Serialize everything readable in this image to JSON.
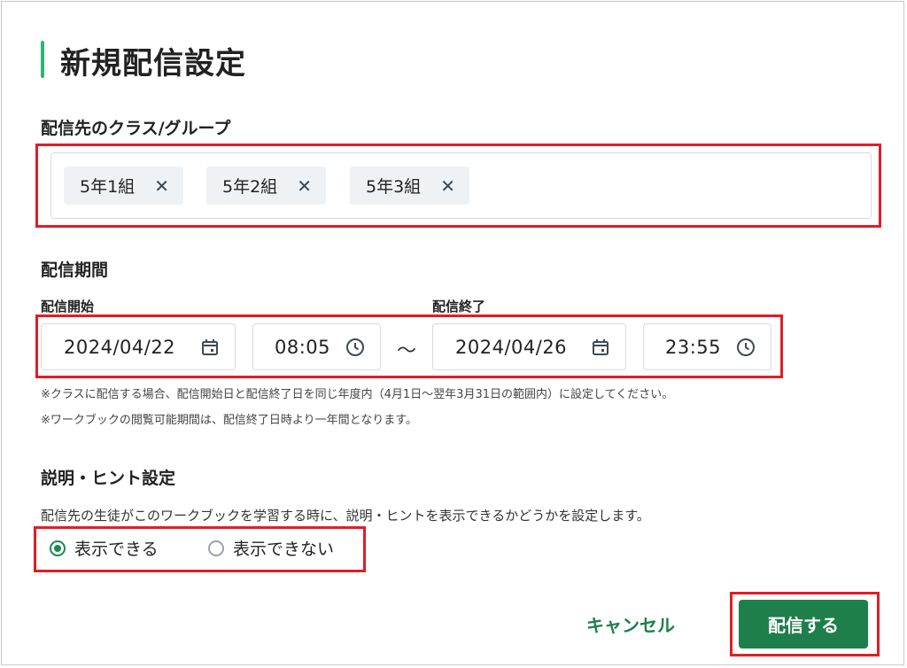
{
  "page": {
    "title": "新規配信設定"
  },
  "classes": {
    "label": "配信先のクラス/グループ",
    "chips": [
      {
        "label": "5年1組",
        "remove_icon": "✕"
      },
      {
        "label": "5年2組",
        "remove_icon": "✕"
      },
      {
        "label": "5年3組",
        "remove_icon": "✕"
      }
    ]
  },
  "period": {
    "label": "配信期間",
    "start_label": "配信開始",
    "end_label": "配信終了",
    "start_date": "2024/04/22",
    "start_time": "08:05",
    "separator": "〜",
    "end_date": "2024/04/26",
    "end_time": "23:55",
    "notes": [
      "※クラスに配信する場合、配信開始日と配信終了日を同じ年度内（4月1日〜翌年3月31日の範囲内）に設定してください。",
      "※ワークブックの閲覧可能期間は、配信終了日時より一年間となります。"
    ]
  },
  "hint": {
    "label": "説明・ヒント設定",
    "description": "配信先の生徒がこのワークブックを学習する時に、説明・ヒントを表示できるかどうかを設定します。",
    "options": [
      {
        "label": "表示できる",
        "selected": true
      },
      {
        "label": "表示できない",
        "selected": false
      }
    ]
  },
  "actions": {
    "cancel": "キャンセル",
    "submit": "配信する"
  },
  "colors": {
    "accent": "#1e7f4c",
    "title_bar": "#2bb673",
    "highlight": "#e11d25"
  },
  "icons": {
    "date": "calendar-icon",
    "time": "clock-icon",
    "remove": "close-icon"
  }
}
